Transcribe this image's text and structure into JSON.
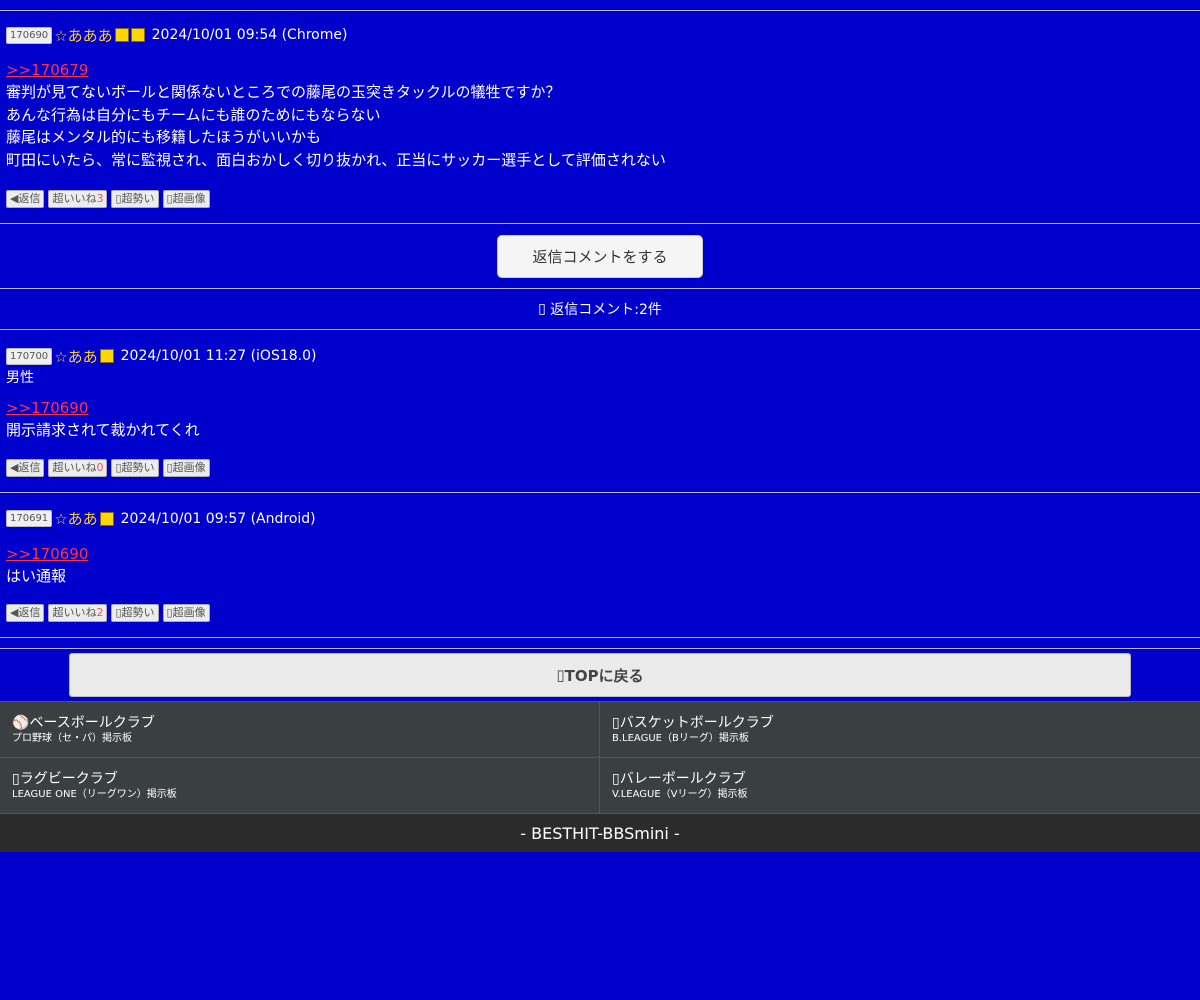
{
  "post_main": {
    "number": "170690",
    "name": "☆あああ",
    "date": "2024/10/01 09:54 (Chrome)",
    "anchor": ">>170679",
    "lines": [
      "審判が見てないボールと関係ないところでの藤尾の玉突きタックルの犠牲ですか？",
      "あんな行為は自分にもチームにも誰のためにもならない",
      "藤尾はメンタル的にも移籍したほうがいいかも",
      "町田にいたら、常に監視され、面白おかしく切り抜かれ、正当にサッカー選手として評価されない"
    ],
    "actions": {
      "reply": "返信",
      "like": "超いいね",
      "like_count": "3",
      "power": "超勢い",
      "image": "超画像"
    }
  },
  "reply_button": "返信コメントをする",
  "reply_count": "返信コメント:2件",
  "replies": [
    {
      "number": "170700",
      "name": "☆ああ",
      "date": "2024/10/01 11:27 (iOS18.0)",
      "gender": "男性",
      "anchor": ">>170690",
      "text": "開示請求されて裁かれてくれ",
      "actions": {
        "reply": "返信",
        "like": "超いいね",
        "like_count": "0",
        "power": "超勢い",
        "image": "超画像"
      }
    },
    {
      "number": "170691",
      "name": "☆ああ",
      "date": "2024/10/01 09:57 (Android)",
      "anchor": ">>170690",
      "text": "はい通報",
      "actions": {
        "reply": "返信",
        "like": "超いいね",
        "like_count": "2",
        "power": "超勢い",
        "image": "超画像"
      }
    }
  ],
  "top_button": "TOPに戻る",
  "clubs": [
    {
      "title": "ベースボールクラブ",
      "sub": "プロ野球（セ・パ）掲示板",
      "icon": "baseball-icon"
    },
    {
      "title": "バスケットボールクラブ",
      "sub": "B.LEAGUE（Bリーグ）掲示板",
      "icon": "basketball-icon"
    },
    {
      "title": "ラグビークラブ",
      "sub": "LEAGUE ONE（リーグワン）掲示板",
      "icon": "rugby-icon"
    },
    {
      "title": "バレーボールクラブ",
      "sub": "V.LEAGUE（Vリーグ）掲示板",
      "icon": "volleyball-icon"
    }
  ],
  "footer": "- BESTHIT-BBSmini -",
  "colors": {
    "background": "#0000cc",
    "anchor": "#ff3344",
    "name": "#ffcc33",
    "badge": "#ffd600"
  }
}
